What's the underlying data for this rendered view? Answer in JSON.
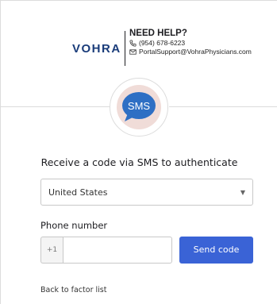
{
  "header": {
    "logo_text": "VOHRA",
    "help_title": "NEED HELP?",
    "help_phone": "(954) 678-6223",
    "help_email": "PortalSupport@VohraPhysicians.com",
    "phone_icon": "phone-icon",
    "email_icon": "envelope-icon"
  },
  "factor": {
    "badge_text": "SMS",
    "badge_icon": "sms-chat-bubble-icon",
    "badge_color": "#2e6fc4",
    "title": "Receive a code via SMS to authenticate"
  },
  "form": {
    "country_value": "United States",
    "phone_label": "Phone number",
    "phone_prefix": "+1",
    "phone_value": "",
    "send_button_label": "Send code",
    "send_button_color": "#3a63d6"
  },
  "footer": {
    "back_link_label": "Back to factor list"
  }
}
